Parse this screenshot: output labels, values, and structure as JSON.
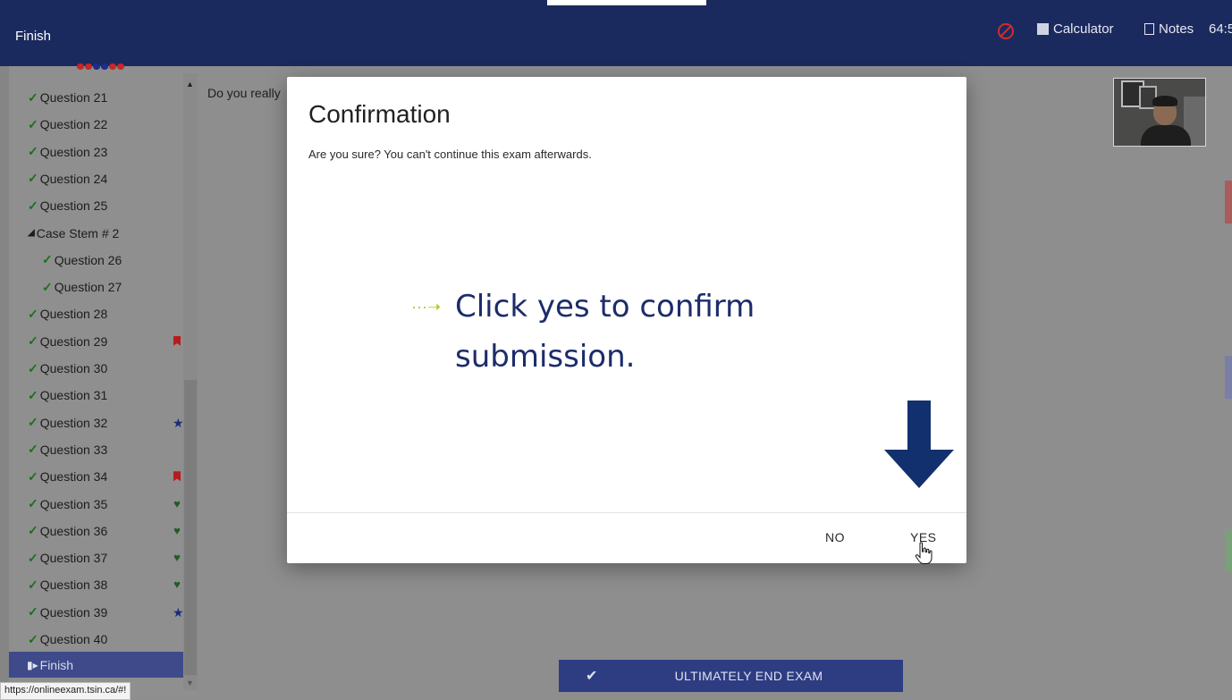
{
  "header": {
    "finish_label": "Finish",
    "calculator_label": "Calculator",
    "notes_label": "Notes",
    "timer": "64:5"
  },
  "sidebar": {
    "progress_dot_colors": [
      "#c62828",
      "#c62828",
      "#1e2d8a",
      "#1e2d8a",
      "#c62828",
      "#c62828"
    ],
    "items": [
      {
        "label": "Question 21",
        "check": "✓",
        "marker": ""
      },
      {
        "label": "Question 22",
        "check": "✓",
        "marker": ""
      },
      {
        "label": "Question 23",
        "check": "✓",
        "marker": ""
      },
      {
        "label": "Question 24",
        "check": "✓",
        "marker": ""
      },
      {
        "label": "Question 25",
        "check": "✓",
        "marker": ""
      },
      {
        "label": "Case Stem # 2",
        "check": "◢",
        "marker": ""
      },
      {
        "label": "Question 26",
        "check": "✓",
        "marker": ""
      },
      {
        "label": "Question 27",
        "check": "✓",
        "marker": ""
      },
      {
        "label": "Question 28",
        "check": "✓",
        "marker": ""
      },
      {
        "label": "Question 29",
        "check": "✓",
        "marker": "bookmark"
      },
      {
        "label": "Question 30",
        "check": "✓",
        "marker": ""
      },
      {
        "label": "Question 31",
        "check": "✓",
        "marker": ""
      },
      {
        "label": "Question 32",
        "check": "✓",
        "marker": "star"
      },
      {
        "label": "Question 33",
        "check": "✓",
        "marker": ""
      },
      {
        "label": "Question 34",
        "check": "✓",
        "marker": "bookmark"
      },
      {
        "label": "Question 35",
        "check": "✓",
        "marker": "heart"
      },
      {
        "label": "Question 36",
        "check": "✓",
        "marker": "heart"
      },
      {
        "label": "Question 37",
        "check": "✓",
        "marker": "heart"
      },
      {
        "label": "Question 38",
        "check": "✓",
        "marker": "heart"
      },
      {
        "label": "Question 39",
        "check": "✓",
        "marker": "star"
      },
      {
        "label": "Question 40",
        "check": "✓",
        "marker": ""
      }
    ],
    "finish_label": "Finish"
  },
  "status_url": "https://onlineexam.tsin.ca/#!",
  "main": {
    "question_text": "Do you really",
    "end_exam_label": "ULTIMATELY END EXAM"
  },
  "modal": {
    "title": "Confirmation",
    "message": "Are you sure? You can't continue this exam afterwards.",
    "no_label": "NO",
    "yes_label": "YES"
  },
  "tutorial": {
    "callout_arrow": "···➝",
    "callout_line1": "Click yes to confirm",
    "callout_line2": "submission.",
    "arrow_color": "#13306e"
  }
}
